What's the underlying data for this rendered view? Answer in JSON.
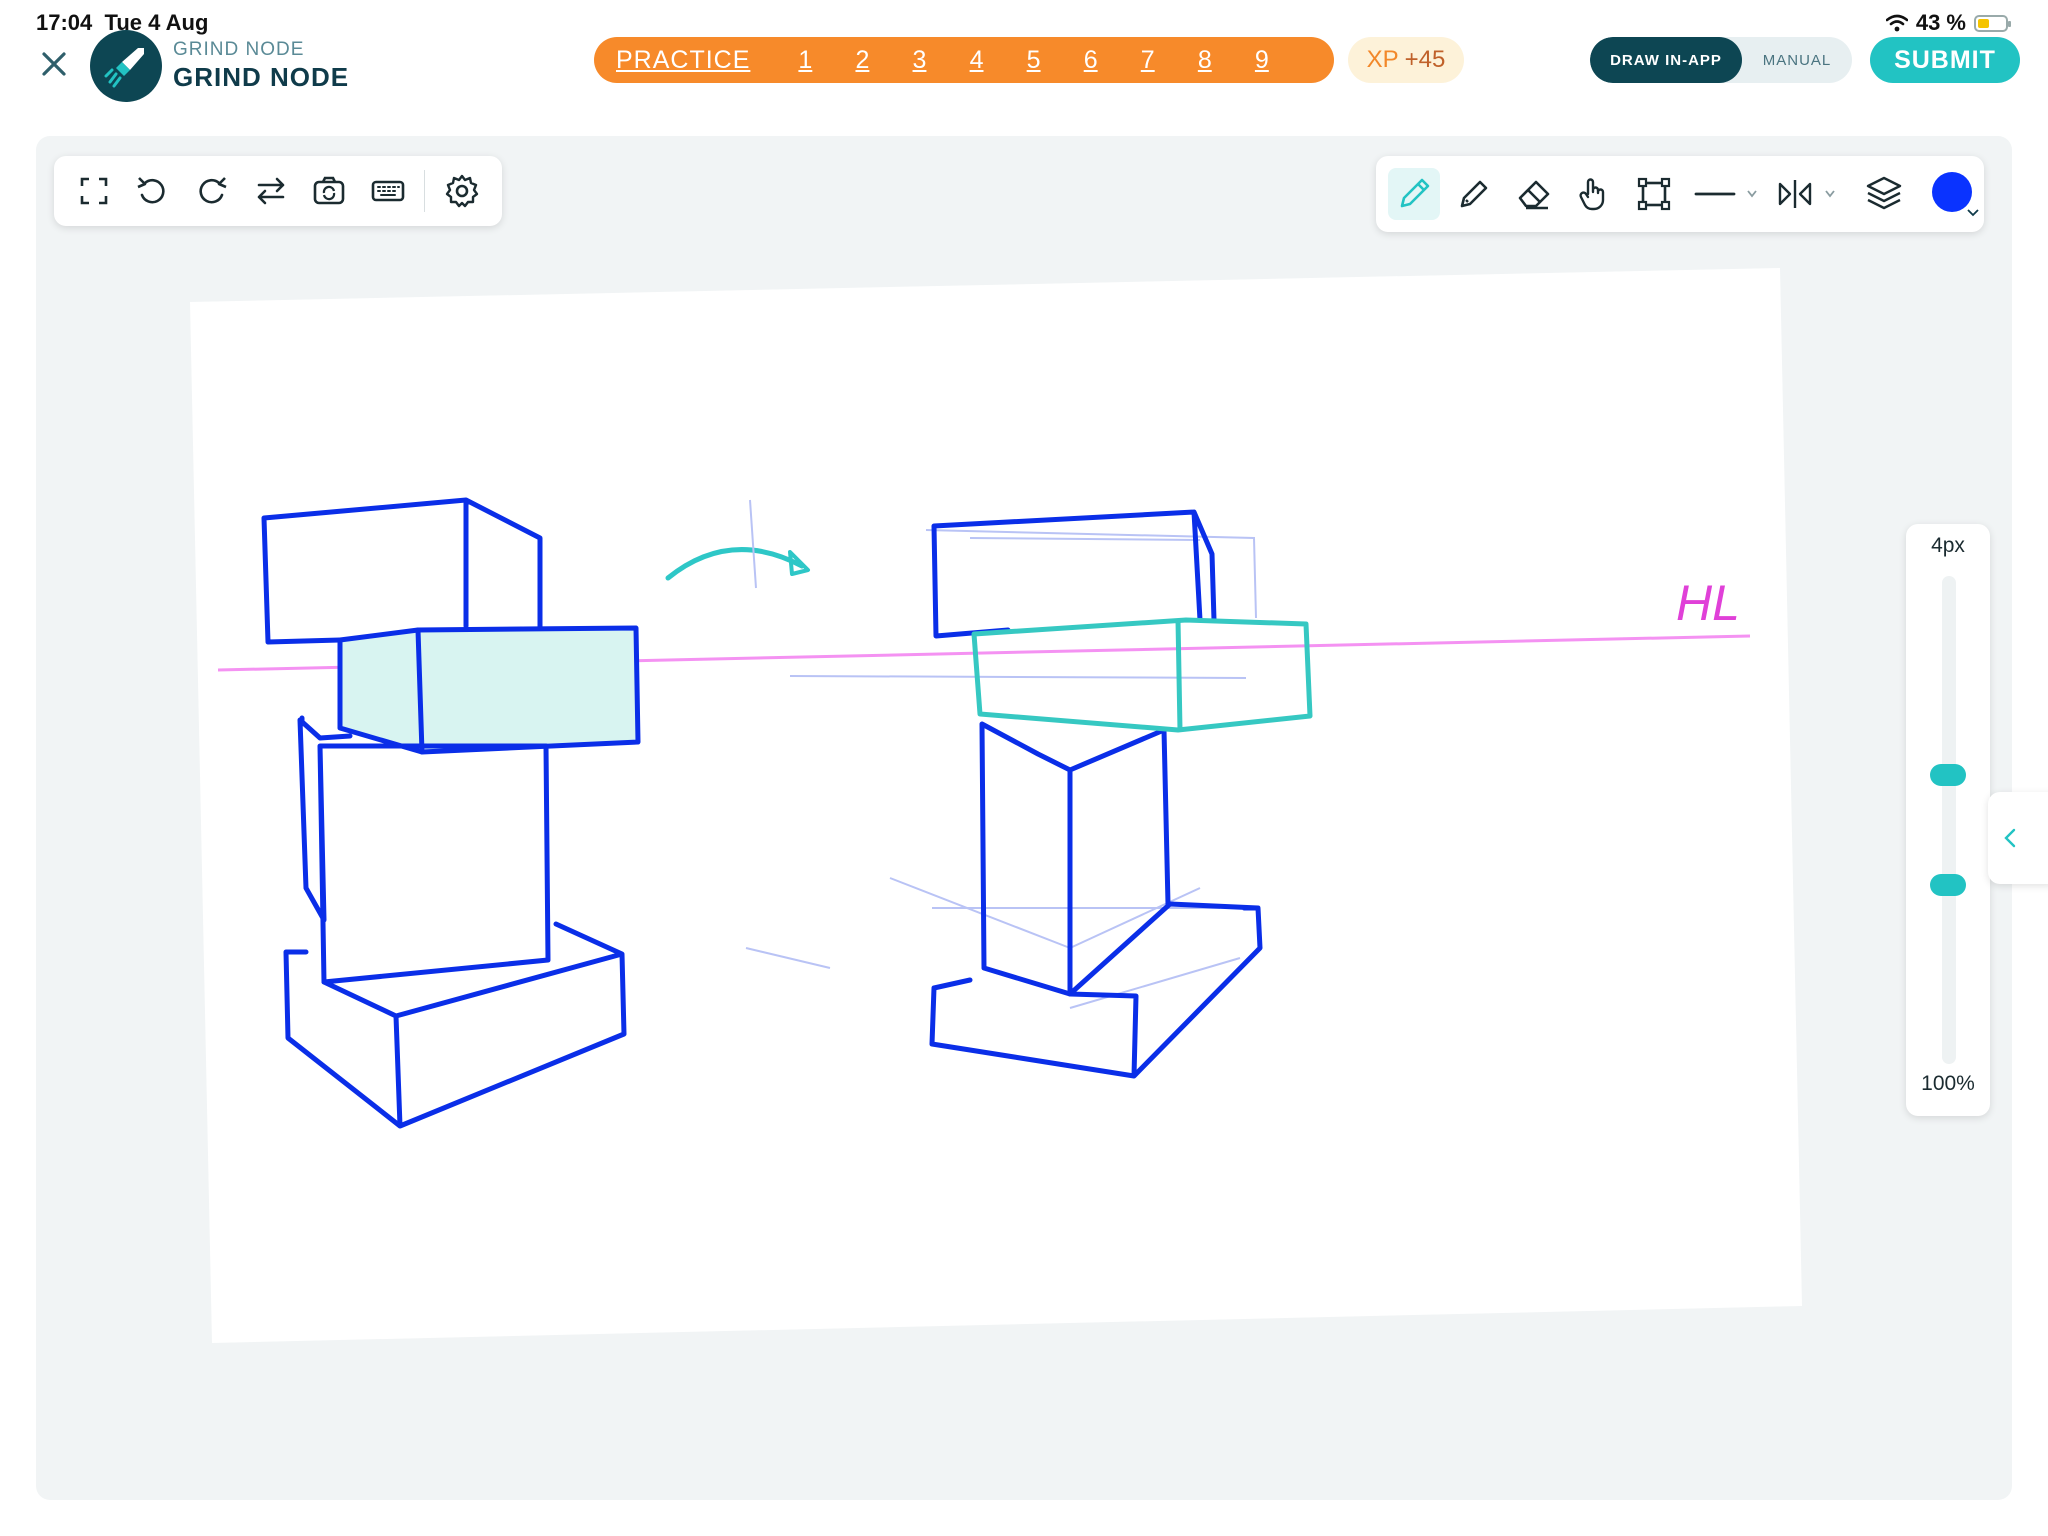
{
  "status_bar": {
    "time": "17:04",
    "date": "Tue 4 Aug",
    "battery_text": "43 %",
    "battery_level": 0.43
  },
  "header": {
    "brand_subtitle": "GRIND NODE",
    "brand_title": "GRIND NODE",
    "nav": {
      "practice_label": "PRACTICE",
      "steps": [
        "1",
        "2",
        "3",
        "4",
        "5",
        "6",
        "7",
        "8",
        "9"
      ]
    },
    "xp_label": "XP",
    "xp_value": "+45",
    "mode_toggle": {
      "options": [
        "DRAW IN-APP",
        "MANUAL"
      ],
      "selected": "DRAW IN-APP"
    },
    "submit_label": "SUBMIT"
  },
  "left_toolbar": {
    "tools": [
      "fullscreen-icon",
      "undo-icon",
      "redo-icon",
      "swap-icon",
      "camera-rotate-icon",
      "keyboard-icon",
      "settings-icon"
    ]
  },
  "right_toolbar": {
    "tools": [
      "pencil-icon",
      "pen-icon",
      "eraser-icon",
      "hand-icon",
      "crop-icon",
      "line-icon",
      "mirror-icon",
      "layers-icon"
    ],
    "active_tool": "pencil-icon",
    "brush_color": "#0a33ff"
  },
  "canvas": {
    "annotation_text": "HL"
  },
  "brush_slider": {
    "size_label": "4px",
    "opacity_label": "100%"
  },
  "colors": {
    "brand_dark": "#0d4653",
    "accent_orange": "#f78a2a",
    "accent_teal": "#22c3c3",
    "stroke_blue": "#0a2ee8",
    "horizon_pink": "#f27ff0"
  }
}
